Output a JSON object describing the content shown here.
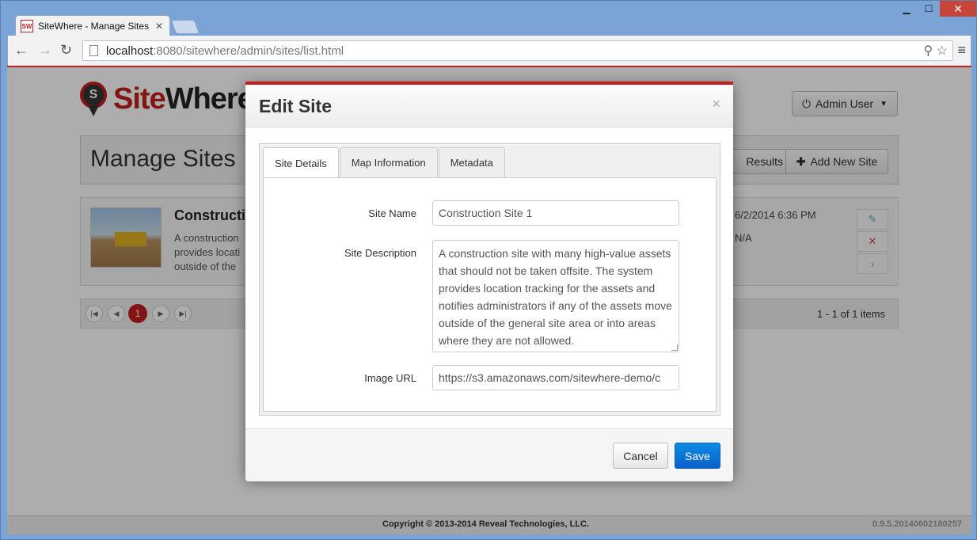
{
  "browser": {
    "tab_title": "SiteWhere - Manage Sites",
    "favicon_text": "SW",
    "url_host": "localhost",
    "url_path": ":8080/sitewhere/admin/sites/list.html"
  },
  "page": {
    "logo_text_red": "Site",
    "logo_text_dark": "Where",
    "logo_pin_letter": "S",
    "admin_label": "Admin User",
    "title": "Manage Sites",
    "filter_label": "Results",
    "add_label": "Add New Site",
    "site": {
      "name": "Construction",
      "desc_lines": [
        "A construction",
        "provides locati",
        "outside of the"
      ],
      "date": "6/2/2014 6:36 PM",
      "na": "N/A"
    },
    "pager": {
      "current": "1",
      "info": "1 - 1 of 1 items"
    },
    "copyright": "Copyright © 2013-2014 Reveal Technologies, LLC.",
    "version": "0.9.5.20140602180257"
  },
  "modal": {
    "title": "Edit Site",
    "close": "×",
    "tabs": [
      "Site Details",
      "Map Information",
      "Metadata"
    ],
    "fields": {
      "site_name_label": "Site Name",
      "site_name_value": "Construction Site 1",
      "site_desc_label": "Site Description",
      "site_desc_value": "A construction site with many high-value assets that should not be taken offsite. The system provides location tracking for the assets and notifies administrators if any of the assets move outside of the general site area or into areas where they are not allowed.",
      "image_url_label": "Image URL",
      "image_url_value": "https://s3.amazonaws.com/sitewhere-demo/c"
    },
    "cancel_label": "Cancel",
    "save_label": "Save"
  },
  "colors": {
    "brand_red": "#c21e1e",
    "save_blue": "#0a6fd6"
  }
}
